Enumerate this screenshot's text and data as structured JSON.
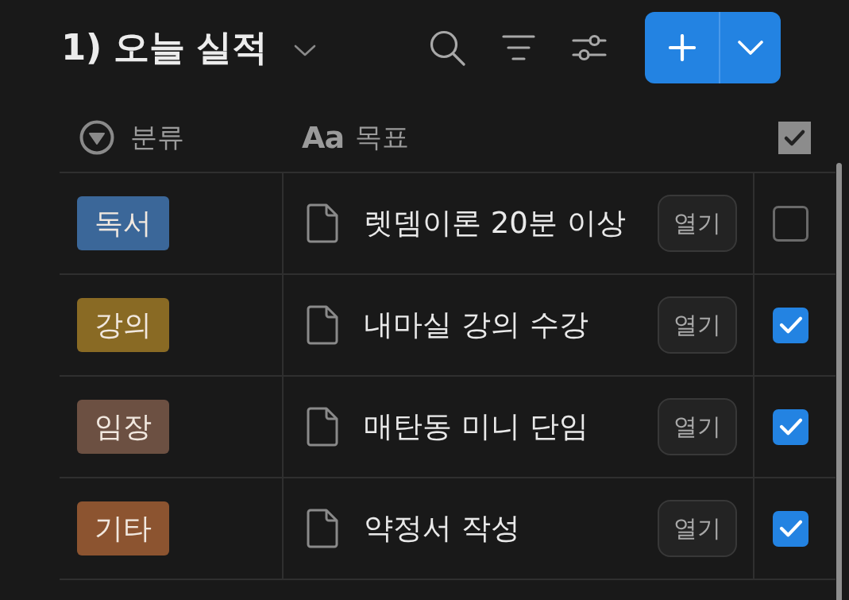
{
  "view": {
    "title": "1) 오늘 실적"
  },
  "table": {
    "columns": [
      {
        "kind": "select",
        "label": "분류"
      },
      {
        "kind": "title",
        "icon_text": "Aa",
        "label": "목표"
      },
      {
        "kind": "checkbox"
      }
    ],
    "rows": [
      {
        "category": {
          "label": "독서",
          "color": "#3b6799"
        },
        "goal": "렛뎀이론 20분 이상",
        "open_button": "열기",
        "checked": false
      },
      {
        "category": {
          "label": "강의",
          "color": "#896a24"
        },
        "goal": "내마실 강의 수강",
        "open_button": "열기",
        "checked": true
      },
      {
        "category": {
          "label": "임장",
          "color": "#6c5042"
        },
        "goal": "매탄동 미니 단임",
        "open_button": "열기",
        "checked": true
      },
      {
        "category": {
          "label": "기타",
          "color": "#8c5430"
        },
        "goal": "약정서 작성",
        "open_button": "열기",
        "checked": true
      }
    ]
  }
}
